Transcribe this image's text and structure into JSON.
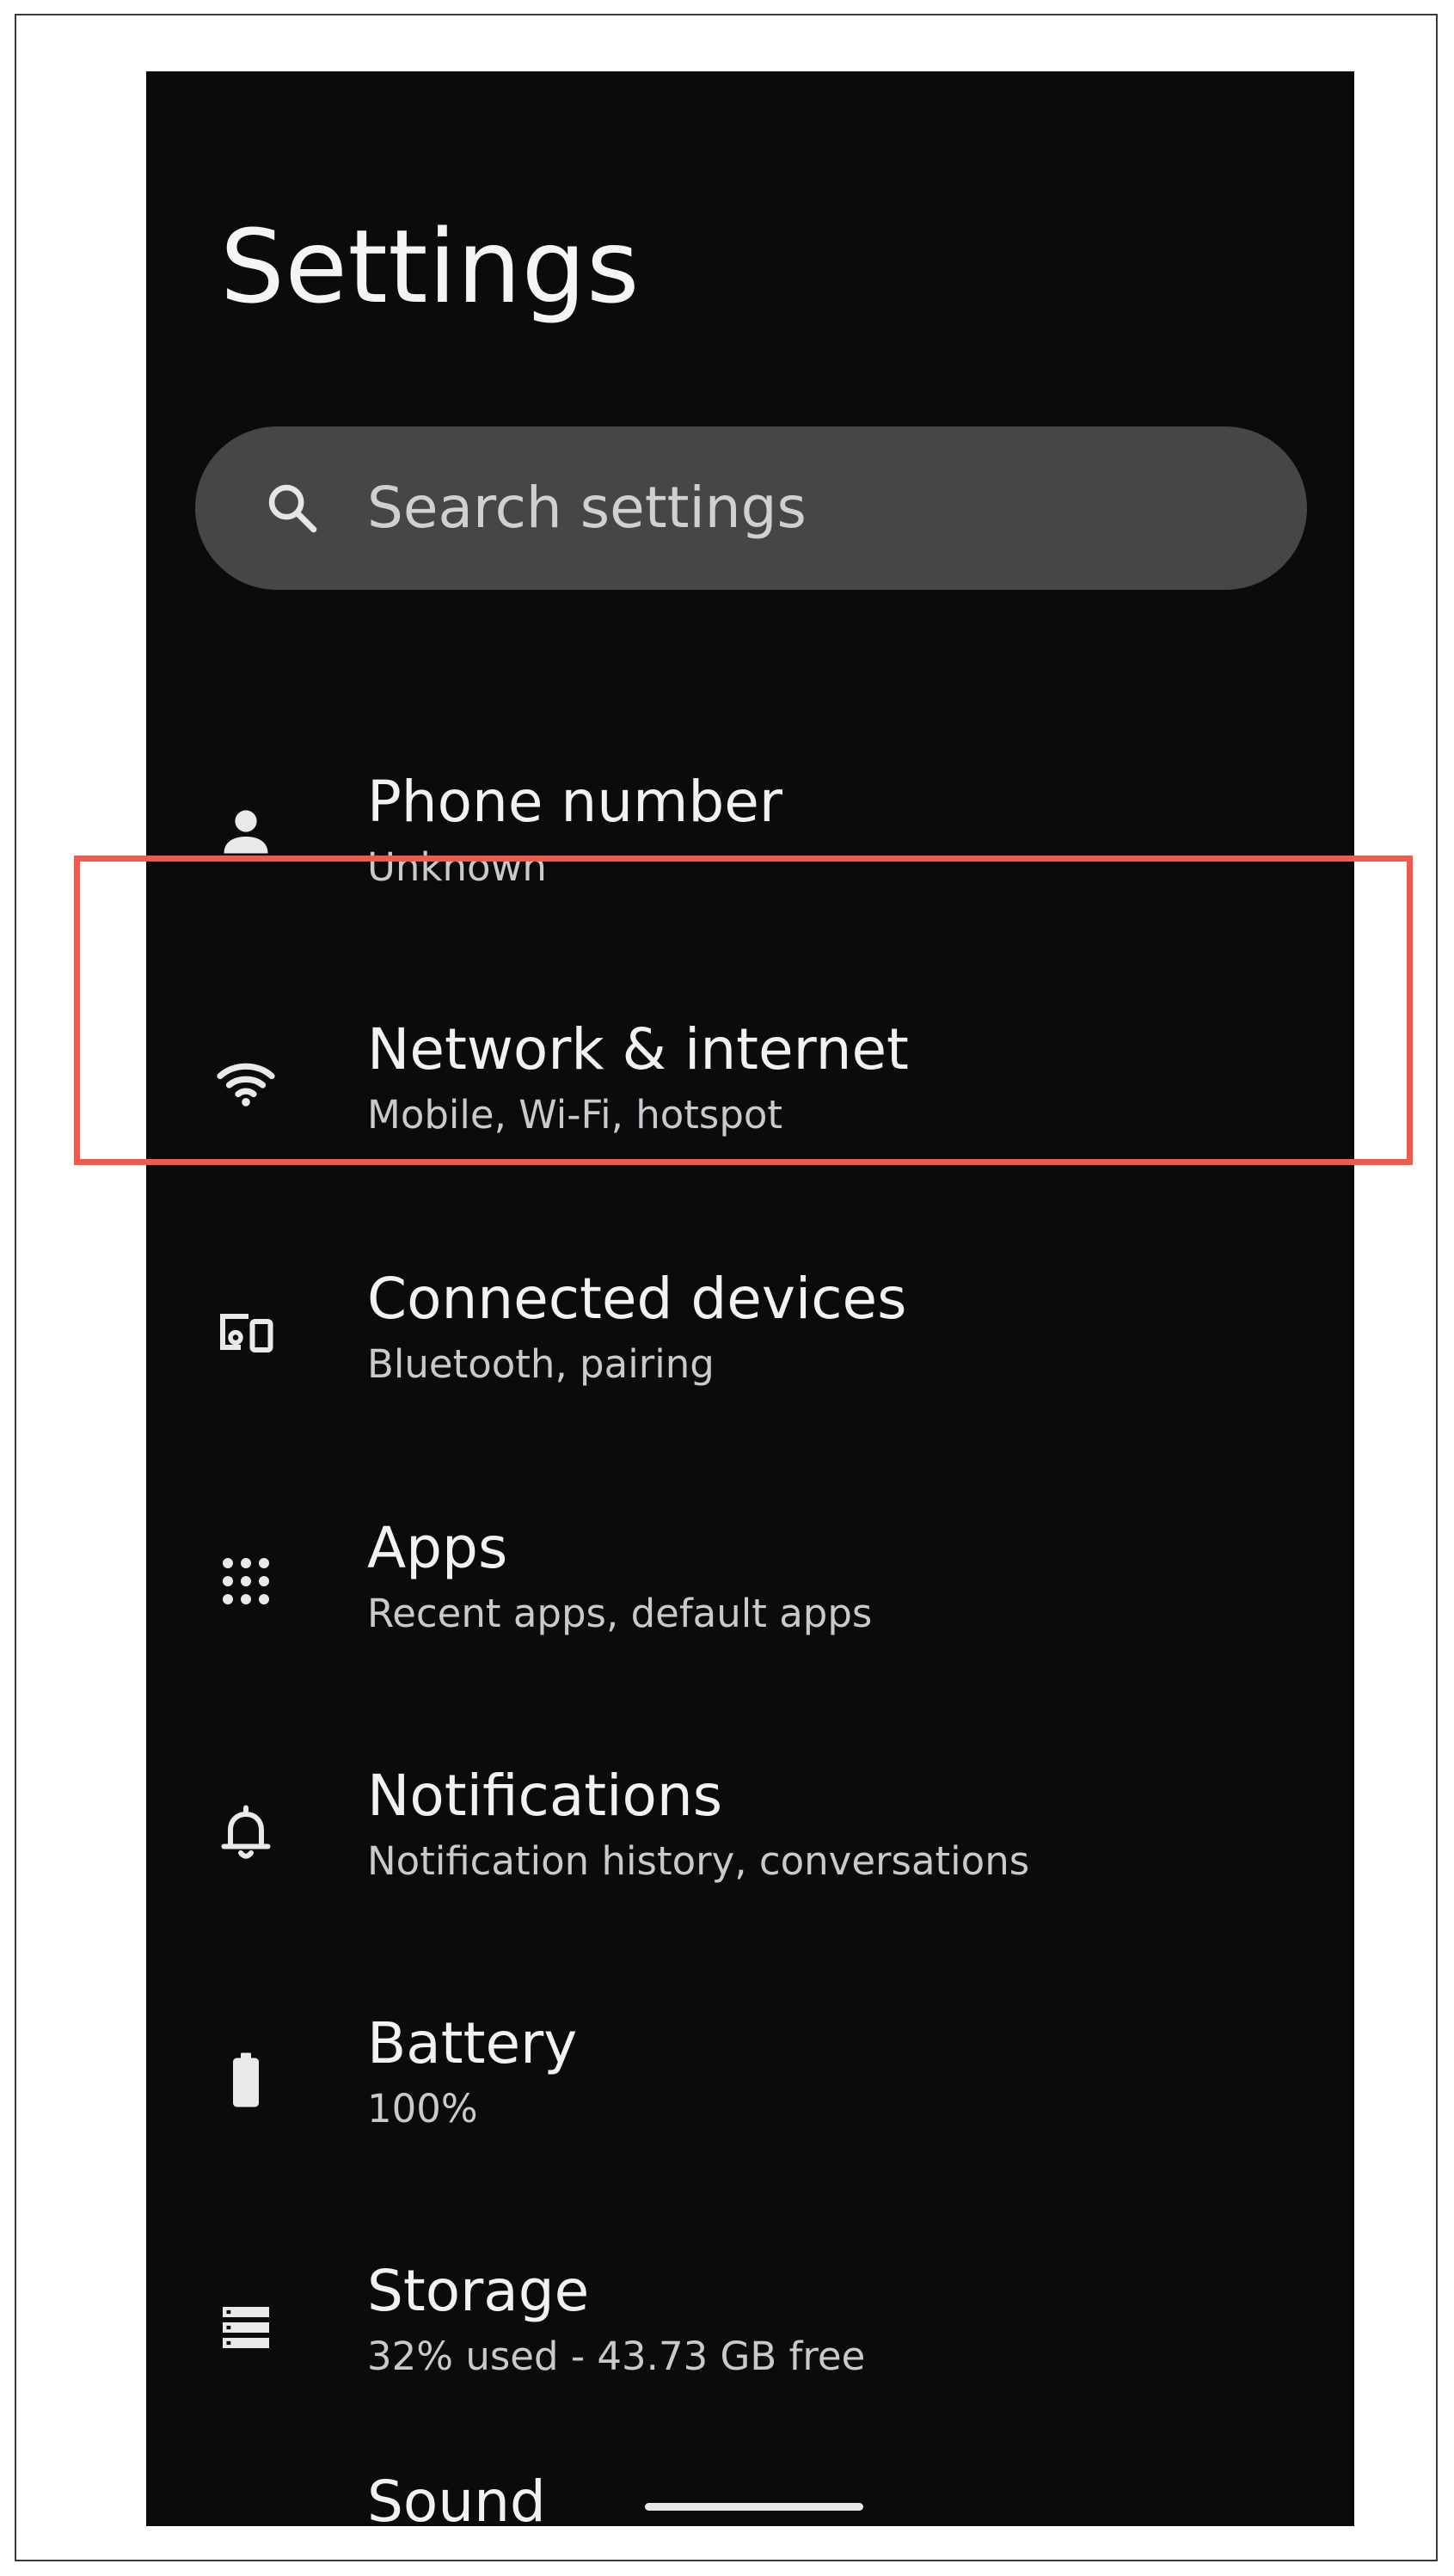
{
  "header": {
    "title": "Settings"
  },
  "search": {
    "placeholder": "Search settings",
    "icon": "search-icon"
  },
  "settings": [
    {
      "id": "phone",
      "icon": "person-icon",
      "title": "Phone number",
      "summary": "Unknown"
    },
    {
      "id": "network",
      "icon": "wifi-icon",
      "title": "Network & internet",
      "summary": "Mobile, Wi-Fi, hotspot",
      "highlighted": true
    },
    {
      "id": "connected",
      "icon": "connected-devices-icon",
      "title": "Connected devices",
      "summary": "Bluetooth, pairing"
    },
    {
      "id": "apps",
      "icon": "apps-grid-icon",
      "title": "Apps",
      "summary": "Recent apps, default apps"
    },
    {
      "id": "notifications",
      "icon": "bell-icon",
      "title": "Notifications",
      "summary": "Notification history, conversations"
    },
    {
      "id": "battery",
      "icon": "battery-icon",
      "title": "Battery",
      "summary": "100%"
    },
    {
      "id": "storage",
      "icon": "storage-icon",
      "title": "Storage",
      "summary": "32% used - 43.73 GB free"
    },
    {
      "id": "sound",
      "icon": "volume-icon",
      "title": "Sound",
      "summary": ""
    }
  ],
  "colors": {
    "background": "#0a0b0d",
    "search_bar": "#454647",
    "highlight": "#f05a4c",
    "title_text": "#f2f2f2",
    "summary_text": "#c9cacc"
  }
}
